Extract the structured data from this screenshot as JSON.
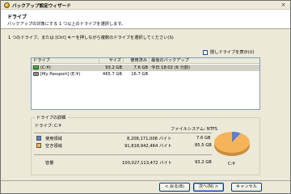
{
  "window": {
    "title": "バックアップ設定ウィザード",
    "close_glyph": "×"
  },
  "header": {
    "title": "ドライブ",
    "subtitle": "バックアップの対象にする 1 つ以上のドライブを選択します。"
  },
  "instruction": "1 つのドライブ、または [Ctrl] キーを押しながら複数のドライブを選択してください(S)",
  "hidden_drives_label": "隠しドライブを表示(U)",
  "list": {
    "columns": [
      "ドライブ",
      "サイズ",
      "使用済み",
      "最後のバックアップ"
    ],
    "rows": [
      {
        "drive": "(C:¥)",
        "size": "93.2 GB",
        "used": "7.6 GB",
        "last_backup": "今日 18:02 (6 分前)"
      },
      {
        "drive": "[My Passport] (E:¥)",
        "size": "465.7 GB",
        "used": "16.7 GB",
        "last_backup": ""
      }
    ]
  },
  "details": {
    "legend": "ドライブの詳細",
    "drive_label": "ドライブ: C:¥",
    "filesystem": "ファイルシステム: NTFS",
    "used_label": "使用領域",
    "used_bytes": "8,208,171,008 バイト",
    "used_gb": "7.6 GB",
    "free_label": "空き領域",
    "free_bytes": "91,818,942,464 バイト",
    "free_gb": "85.5 GB",
    "capacity_label": "容量",
    "capacity_bytes": "100,027,113,472 バイト",
    "capacity_gb": "93.2 GB",
    "pie_label": "C:¥",
    "used_fraction": 0.082,
    "colors": {
      "used": "#5b7fd6",
      "free": "#f5b45a"
    }
  },
  "buttons": {
    "back": "< 戻る(B)",
    "next": "次へ(N) >",
    "cancel": "キャンセル"
  }
}
